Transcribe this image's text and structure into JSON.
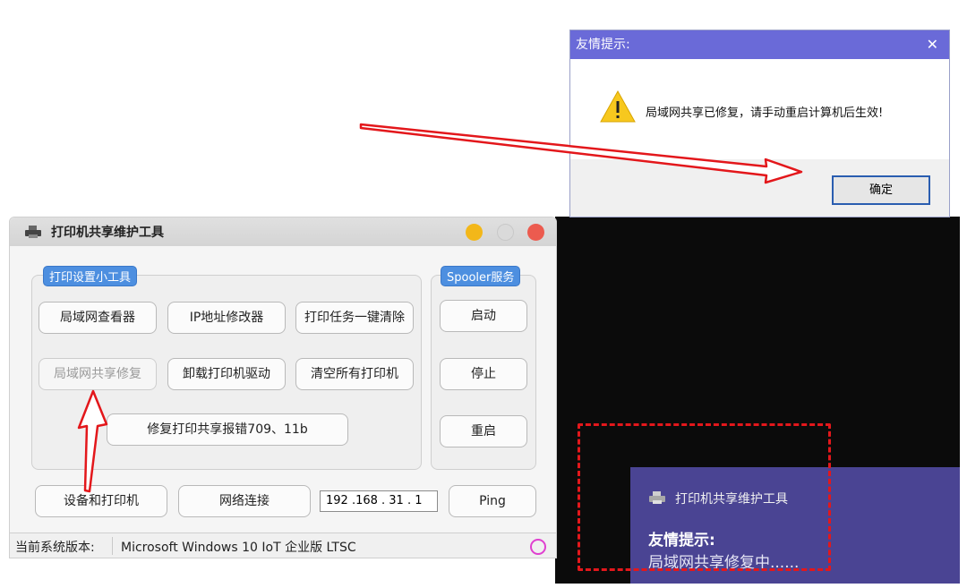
{
  "dialog": {
    "title": "友情提示:",
    "close_glyph": "✕",
    "icon": "warning-icon",
    "message": "局域网共享已修复，请手动重启计算机后生效!",
    "ok_label": "确定"
  },
  "app": {
    "title": "打印机共享维护工具",
    "icon": "printer-icon",
    "print_group": {
      "label": "打印设置小工具",
      "buttons": {
        "lan_viewer": "局域网查看器",
        "ip_modifier": "IP地址修改器",
        "clear_jobs": "打印任务一键清除",
        "lan_share_fix": "局域网共享修复",
        "uninstall_driver": "卸载打印机驱动",
        "clear_printers": "清空所有打印机",
        "fix_error": "修复打印共享报错709、11b"
      }
    },
    "spooler_group": {
      "label": "Spooler服务",
      "buttons": {
        "start": "启动",
        "stop": "停止",
        "restart": "重启"
      }
    },
    "bottom": {
      "devices": "设备和打印机",
      "network": "网络连接",
      "ip_value": "192 .168 . 31  . 1",
      "ping": "Ping"
    },
    "status": {
      "label": "当前系统版本:",
      "value": "Microsoft Windows 10 IoT 企业版 LTSC"
    }
  },
  "toast": {
    "app_name": "打印机共享维护工具",
    "title": "友情提示:",
    "message": "局域网共享修复中......"
  },
  "colors": {
    "dialog_title": "#6a6ad8",
    "group_label": "#4d8fe0",
    "toast_bg": "#4a4493",
    "annotation_red": "#e3171b"
  }
}
